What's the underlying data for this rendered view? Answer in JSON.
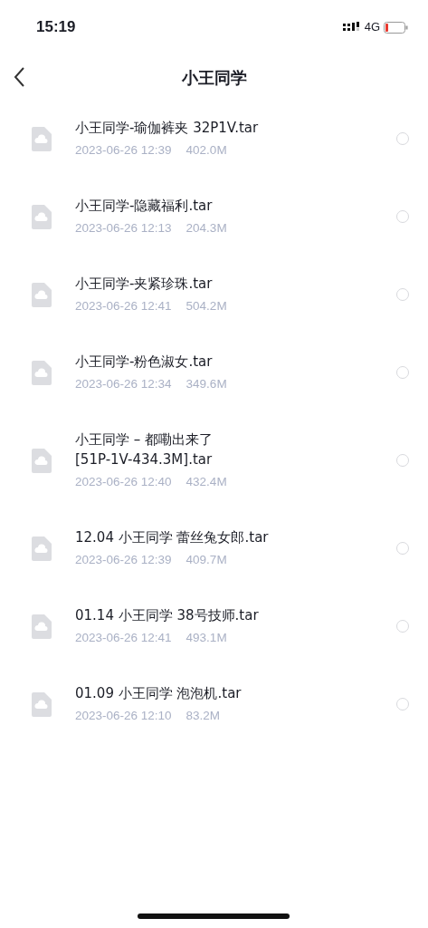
{
  "status_bar": {
    "time": "15:19",
    "network": "4G"
  },
  "nav": {
    "title": "小王同学"
  },
  "files": [
    {
      "name": "小王同学-瑜伽裤夹 32P1V.tar",
      "date": "2023-06-26 12:39",
      "size": "402.0M",
      "selected": false
    },
    {
      "name": "小王同学-隐藏福利.tar",
      "date": "2023-06-26 12:13",
      "size": "204.3M",
      "selected": false
    },
    {
      "name": "小王同学-夹紧珍珠.tar",
      "date": "2023-06-26 12:41",
      "size": "504.2M",
      "selected": false
    },
    {
      "name": "小王同学-粉色淑女.tar",
      "date": "2023-06-26 12:34",
      "size": "349.6M",
      "selected": false
    },
    {
      "name": "小王同学 – 都嘞出来了\n[51P-1V-434.3M].tar",
      "date": "2023-06-26 12:40",
      "size": "432.4M",
      "selected": false
    },
    {
      "name": "12.04 小王同学 蕾丝兔女郎.tar",
      "date": "2023-06-26 12:39",
      "size": "409.7M",
      "selected": false
    },
    {
      "name": "01.14 小王同学 38号技师.tar",
      "date": "2023-06-26 12:41",
      "size": "493.1M",
      "selected": false
    },
    {
      "name": "01.09 小王同学 泡泡机.tar",
      "date": "2023-06-26 12:10",
      "size": "83.2M",
      "selected": false
    }
  ]
}
